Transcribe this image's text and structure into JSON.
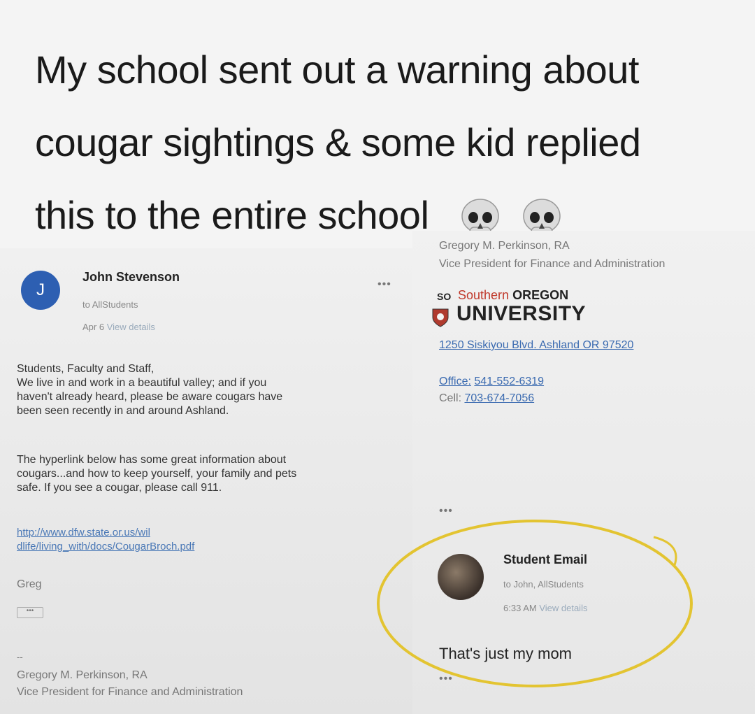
{
  "headline": {
    "line1": "My school sent out a warning about",
    "line2": "cougar sightings & some kid replied",
    "line3": "this to the entire school",
    "emoji": [
      "skull-emoji",
      "skull-emoji"
    ]
  },
  "left_email": {
    "avatar_letter": "J",
    "avatar_color": "#2d5fb2",
    "sender": "John Stevenson",
    "to": "to AllStudents",
    "date": "Apr 6",
    "view_details": "View details",
    "menu": "•••",
    "body": [
      "Students, Faculty and Staff,",
      "We live in and work in a beautiful valley; and if you",
      "haven't already heard, please be aware cougars have",
      "been seen recently in and around Ashland."
    ],
    "body2": [
      "The hyperlink below has some great information about",
      "cougars...and how to keep yourself, your family and pets",
      "safe.  If you see a cougar, please call 911."
    ],
    "link": [
      "http://www.dfw.state.or.us/wil",
      "dlife/living_with/docs/CougarBroch.pdf"
    ],
    "signoff": "Greg",
    "collapsed": "•••",
    "dash": "--",
    "sig_name": "Gregory M. Perkinson, RA",
    "sig_title": "Vice President for Finance and Administration"
  },
  "right_email": {
    "sig_name": "Gregory M. Perkinson, RA",
    "sig_title": "Vice President for Finance and Administration",
    "logo_badge": "SO",
    "logo_southern": "Southern",
    "logo_oregon": "OREGON",
    "logo_university": "UNIVERSITY",
    "address": "1250 Siskiyou Blvd. Ashland  OR 97520",
    "office_label": "Office:",
    "office_number": "541-552-6319",
    "cell_label": "Cell:",
    "cell_number": "703-674-7056",
    "more_dots": "•••",
    "reply": {
      "sender": "Student Email",
      "to": "to John, AllStudents",
      "time": "6:33 AM",
      "view_details": "View details",
      "text": "That's just my mom",
      "more_dots": "•••"
    },
    "highlight_color": "#e3c431"
  }
}
